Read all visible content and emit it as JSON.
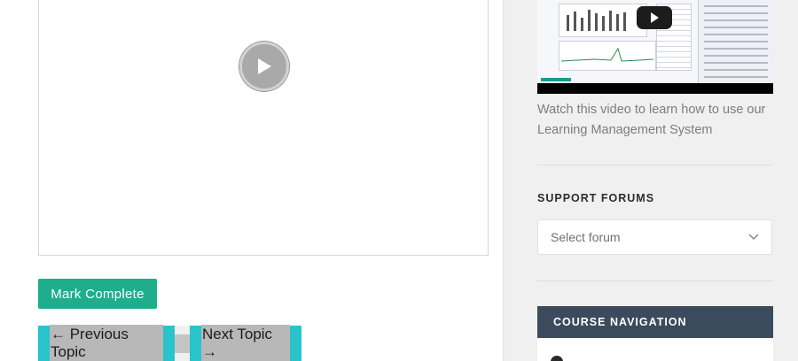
{
  "main": {
    "mark_complete_label": "Mark Complete",
    "prev_topic_label": "← Previous Topic",
    "next_topic_label": "Next Topic →"
  },
  "sidebar": {
    "video_caption": "Watch this video to learn how to use our Learning Management System",
    "support_forums_title": "SUPPORT FORUMS",
    "forum_select": {
      "selected": "Select forum"
    },
    "course_navigation_title": "COURSE NAVIGATION"
  },
  "colors": {
    "mark_complete": "#1fae8c",
    "nav_buttons": "#29c3cc",
    "course_nav_header": "#3b4a5c"
  },
  "icons": [
    "play-icon",
    "youtube-play-icon",
    "chevron-down-icon",
    "course-nav-item-icon"
  ]
}
